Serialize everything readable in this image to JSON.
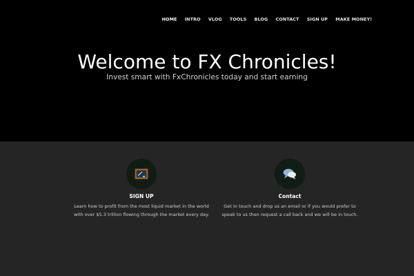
{
  "nav": {
    "items": [
      {
        "label": "HOME",
        "active": true
      },
      {
        "label": "INTRO",
        "active": false
      },
      {
        "label": "VLOG",
        "active": false
      },
      {
        "label": "TOOLS",
        "active": false
      },
      {
        "label": "BLOG",
        "active": false
      },
      {
        "label": "CONTACT",
        "active": false
      },
      {
        "label": "SIGN UP",
        "active": false
      },
      {
        "label": "MAKE MONEY!",
        "active": false
      }
    ]
  },
  "hero": {
    "title": "Welcome to FX Chronicles!",
    "subtitle": "Invest smart with FxChronicles today and start earning"
  },
  "features": [
    {
      "icon": "chalkboard-icon",
      "title": "SIGN UP",
      "text": "Learn how to profit from the most liquid market in the world with over $5.3 trillion flowing through the market every day."
    },
    {
      "icon": "speech-bubbles-icon",
      "title": "Contact",
      "text": "Get in touch and drop us an email or if you would prefer to speak to us then request a call back and we will be in touch."
    }
  ],
  "colors": {
    "hero_background": "#000000",
    "section_background": "#252525",
    "icon_circle": "#0f1d14"
  }
}
